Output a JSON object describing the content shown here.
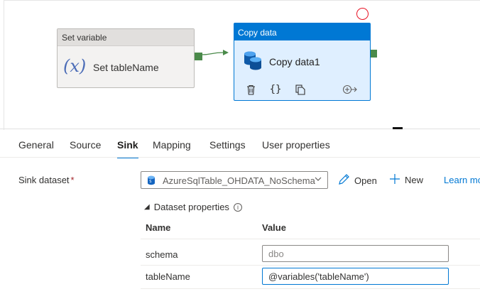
{
  "canvas": {
    "set_variable_node": {
      "header": "Set variable",
      "icon": "(x)",
      "label": "Set tableName"
    },
    "copy_node": {
      "header": "Copy data",
      "label": "Copy data1",
      "actions": [
        "delete-icon",
        "code-icon",
        "copy-icon",
        "add-output-icon"
      ]
    }
  },
  "tabs": [
    {
      "label": "General",
      "active": false
    },
    {
      "label": "Source",
      "active": false
    },
    {
      "label": "Sink",
      "active": true
    },
    {
      "label": "Mapping",
      "active": false
    },
    {
      "label": "Settings",
      "active": false
    },
    {
      "label": "User properties",
      "active": false
    }
  ],
  "sink": {
    "dataset_label": "Sink dataset",
    "required_mark": "*",
    "dataset_value": "AzureSqlTable_OHDATA_NoSchema",
    "open_label": "Open",
    "new_label": "New",
    "learn_more_label": "Learn mo",
    "dataset_properties_label": "Dataset properties",
    "info_icon_glyph": "i",
    "columns": {
      "name": "Name",
      "value": "Value"
    },
    "properties": [
      {
        "name": "schema",
        "value": "dbo"
      },
      {
        "name": "tableName",
        "value": "@variables('tableName')"
      }
    ]
  },
  "colors": {
    "accent": "#0078d4",
    "connector": "#4a8a4a",
    "node_selected_bg": "#dfefff",
    "marker_red": "#e81123"
  }
}
